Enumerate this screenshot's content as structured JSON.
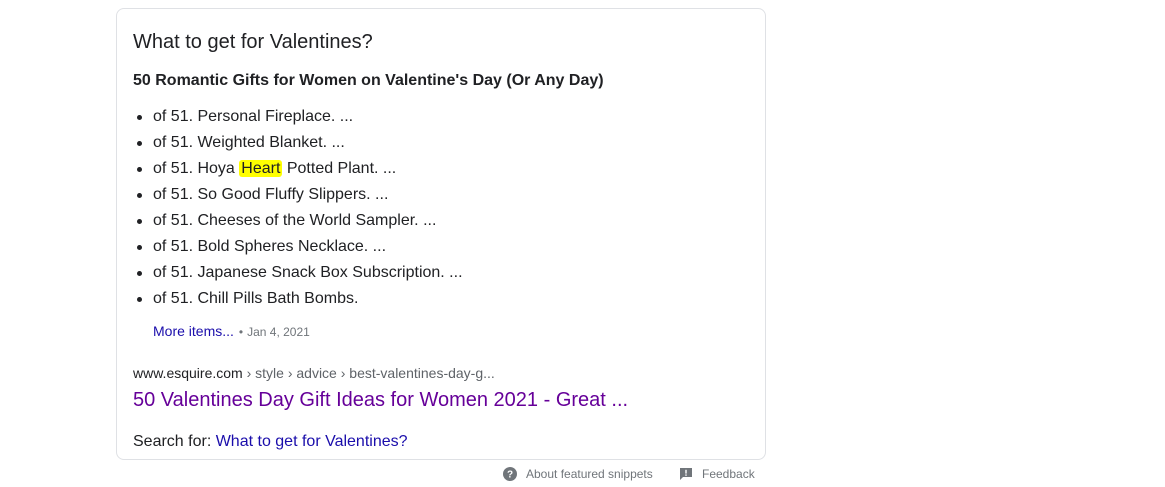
{
  "snippet": {
    "question": "What to get for Valentines?",
    "heading": "50 Romantic Gifts for Women on Valentine's Day (Or Any Day)",
    "items": [
      {
        "text": "of 51. Personal Fireplace. ..."
      },
      {
        "text": "of 51. Weighted Blanket. ..."
      },
      {
        "pre": "of 51. Hoya ",
        "highlight": "Heart",
        "post": " Potted Plant. ..."
      },
      {
        "text": "of 51. So Good Fluffy Slippers. ..."
      },
      {
        "text": "of 51. Cheeses of the World Sampler. ..."
      },
      {
        "text": "of 51. Bold Spheres Necklace. ..."
      },
      {
        "text": "of 51. Japanese Snack Box Subscription. ..."
      },
      {
        "text": "of 51. Chill Pills Bath Bombs."
      }
    ],
    "more_items_label": "More items...",
    "separator": "•",
    "date": "Jan 4, 2021",
    "url_domain": "www.esquire.com",
    "url_path": " › style › advice › best-valentines-day-g...",
    "result_title": "50 Valentines Day Gift Ideas for Women 2021 - Great ...",
    "search_for_label": "Search for: ",
    "search_for_link": "What to get for Valentines?"
  },
  "footer": {
    "about_label": "About featured snippets",
    "feedback_label": "Feedback"
  },
  "icons": {
    "about": "help-circle-icon",
    "feedback": "feedback-icon"
  },
  "colors": {
    "link": "#1a0dab",
    "visited": "#660099",
    "highlight": "#ffff00",
    "muted": "#70757a"
  }
}
